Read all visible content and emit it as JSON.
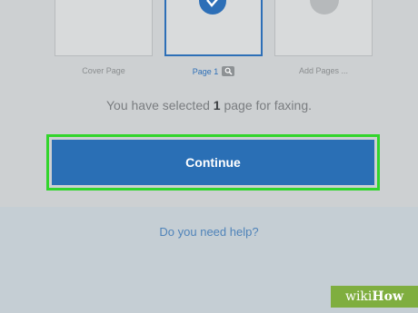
{
  "thumbnails": [
    {
      "label": "Cover Page"
    },
    {
      "label": "Page 1"
    },
    {
      "label": "Add Pages ..."
    }
  ],
  "summary": {
    "prefix": "You have selected",
    "count": "1",
    "suffix": "page for faxing."
  },
  "continue_label": "Continue",
  "help_link": "Do you need help?",
  "watermark": {
    "wiki": "wiki",
    "how": "How"
  },
  "colors": {
    "accent": "#2a6fb5",
    "highlight": "#32d52c"
  }
}
